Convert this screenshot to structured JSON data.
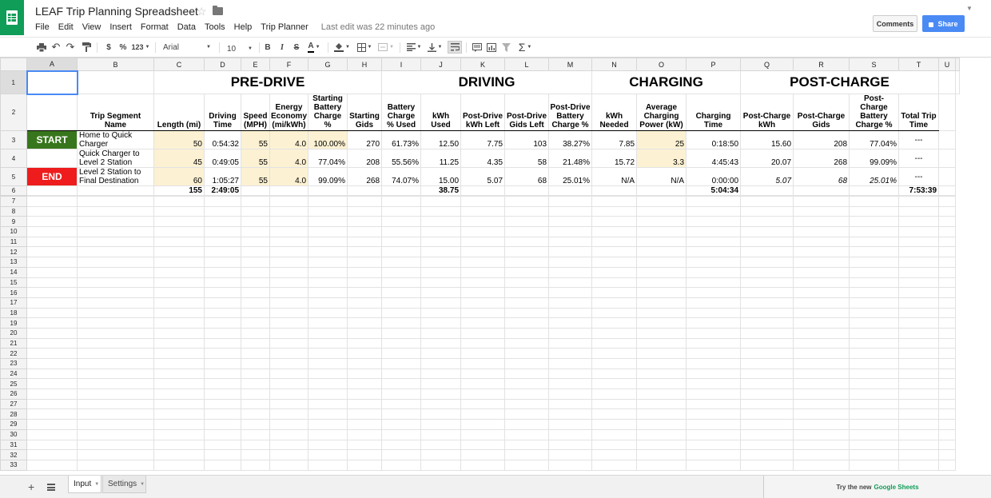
{
  "app": {
    "title": "LEAF Trip Planning Spreadsheet",
    "last_edit": "Last edit was 22 minutes ago",
    "comments_label": "Comments",
    "share_label": "Share",
    "brand_color": "#0f9d58",
    "share_color": "#4a8af4"
  },
  "menu": [
    "File",
    "Edit",
    "View",
    "Insert",
    "Format",
    "Data",
    "Tools",
    "Help",
    "Trip Planner"
  ],
  "toolbar": {
    "print_icon": "printer-icon",
    "undo_icon": "undo-icon",
    "redo_icon": "redo-icon",
    "paint_format_icon": "paint-format-icon",
    "currency": "$",
    "percent": "%",
    "more_formats": "123",
    "font": "Arial",
    "font_size": "10",
    "bold": "B",
    "italic": "I",
    "strikethrough": "S",
    "text_color": "A",
    "functions": "Σ"
  },
  "columns": [
    "A",
    "B",
    "C",
    "D",
    "E",
    "F",
    "G",
    "H",
    "I",
    "J",
    "K",
    "L",
    "M",
    "N",
    "O",
    "P",
    "Q",
    "R",
    "S",
    "T",
    "U"
  ],
  "sections": {
    "pre_drive": "PRE-DRIVE",
    "driving": "DRIVING",
    "charging": "CHARGING",
    "post_charge": "POST-CHARGE"
  },
  "headers": {
    "segment": "Trip Segment Name",
    "length": "Length (mi)",
    "driving_time": "Driving Time",
    "speed": "Speed (MPH)",
    "energy_economy": "Energy Economy (mi/kWh)",
    "starting_charge": "Starting Battery Charge %",
    "starting_gids": "Starting Gids",
    "charge_used": "Battery Charge % Used",
    "kwh_used": "kWh Used",
    "post_drive_kwh": "Post-Drive kWh Left",
    "post_drive_gids": "Post-Drive Gids Left",
    "post_drive_charge": "Post-Drive Battery Charge %",
    "kwh_needed": "kWh Needed",
    "avg_power": "Average Charging Power (kW)",
    "charging_time": "Charging Time",
    "post_charge_kwh": "Post-Charge kWh",
    "post_charge_gids": "Post-Charge Gids",
    "post_charge_pct": "Post-Charge Battery Charge %",
    "total_time": "Total Trip Time"
  },
  "buttons": {
    "start": "START",
    "end": "END"
  },
  "rows": [
    {
      "segment": "Home to Quick Charger",
      "length": "50",
      "driving_time": "0:54:32",
      "speed": "55",
      "economy": "4.0",
      "start_charge": "100.00%",
      "start_gids": "270",
      "charge_used": "61.73%",
      "kwh_used": "12.50",
      "post_kwh": "7.75",
      "post_gids": "103",
      "post_charge": "38.27%",
      "kwh_needed": "7.85",
      "avg_power": "25",
      "charging_time": "0:18:50",
      "pc_kwh": "15.60",
      "pc_gids": "208",
      "pc_pct": "77.04%",
      "total": "---"
    },
    {
      "segment": "Quick Charger to Level 2 Station",
      "length": "45",
      "driving_time": "0:49:05",
      "speed": "55",
      "economy": "4.0",
      "start_charge": "77.04%",
      "start_gids": "208",
      "charge_used": "55.56%",
      "kwh_used": "11.25",
      "post_kwh": "4.35",
      "post_gids": "58",
      "post_charge": "21.48%",
      "kwh_needed": "15.72",
      "avg_power": "3.3",
      "charging_time": "4:45:43",
      "pc_kwh": "20.07",
      "pc_gids": "268",
      "pc_pct": "99.09%",
      "total": "---"
    },
    {
      "segment": "Level 2 Station to Final Destination",
      "length": "60",
      "driving_time": "1:05:27",
      "speed": "55",
      "economy": "4.0",
      "start_charge": "99.09%",
      "start_gids": "268",
      "charge_used": "74.07%",
      "kwh_used": "15.00",
      "post_kwh": "5.07",
      "post_gids": "68",
      "post_charge": "25.01%",
      "kwh_needed": "N/A",
      "avg_power": "N/A",
      "charging_time": "0:00:00",
      "pc_kwh": "5.07",
      "pc_gids": "68",
      "pc_pct": "25.01%",
      "total": "---"
    }
  ],
  "totals": {
    "length": "155",
    "driving_time": "2:49:05",
    "kwh_used": "38.75",
    "charging_time": "5:04:34",
    "total_time": "7:53:39"
  },
  "sheets": {
    "input": "Input",
    "settings": "Settings"
  },
  "promo": {
    "prefix": "Try the new",
    "link": "Google Sheets"
  }
}
